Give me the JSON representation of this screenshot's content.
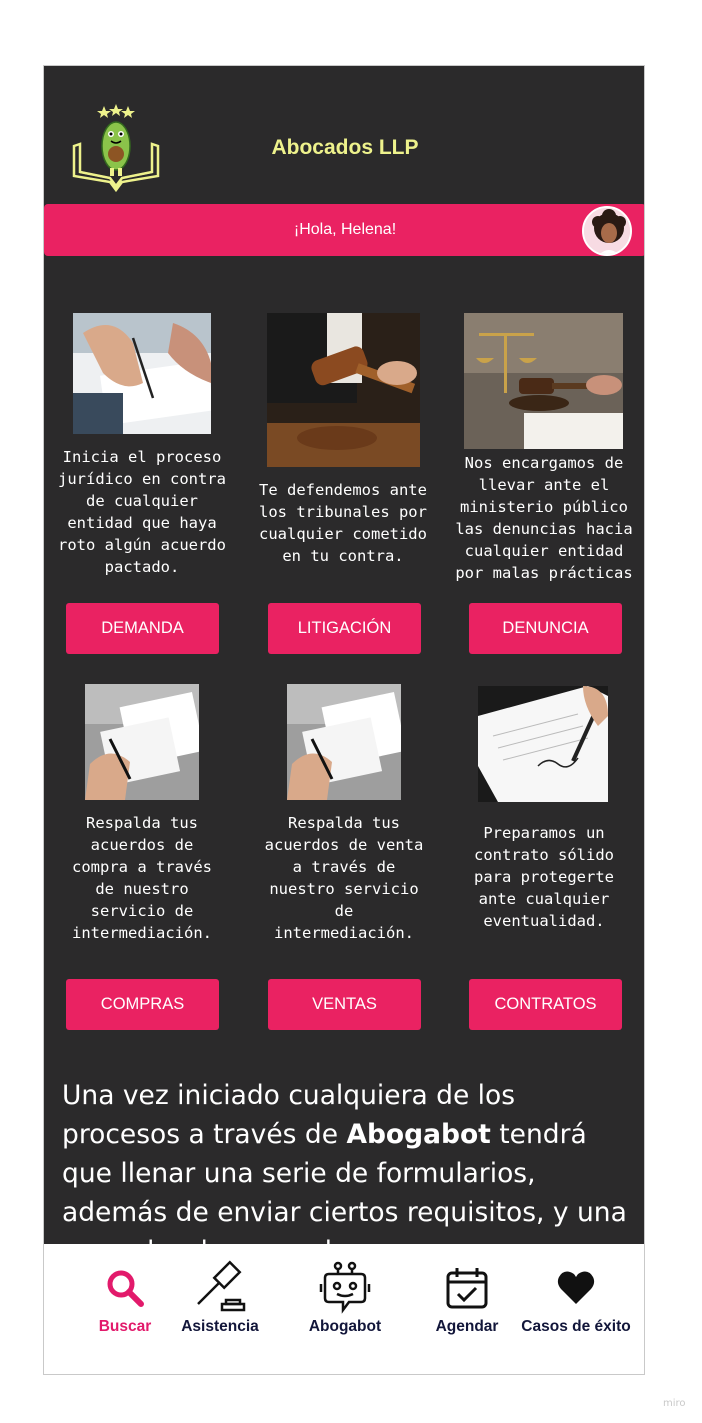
{
  "app": {
    "title": "Abocados LLP"
  },
  "greeting": {
    "text": "¡Hola, Helena!"
  },
  "services": [
    {
      "image": "contract-signing-photo",
      "description": "Inicia el proceso jurídico en contra de cualquier entidad que haya roto algún acuerdo pactado.",
      "button": "DEMANDA"
    },
    {
      "image": "judge-gavel-photo",
      "description": "Te defendemos ante los tribunales por cualquier cometido en tu contra.",
      "button": "LITIGACIÓN"
    },
    {
      "image": "scales-of-justice-photo",
      "description": "Nos encargamos de llevar ante el ministerio público las denuncias hacia cualquier entidad por malas prácticas",
      "button": "DENUNCIA"
    },
    {
      "image": "signing-document-photo",
      "description": "Respalda tus acuerdos de compra a través de nuestro servicio de intermediación.",
      "button": "COMPRAS"
    },
    {
      "image": "signing-document-photo",
      "description": "Respalda tus acuerdos de venta a través de nuestro servicio de intermediación.",
      "button": "VENTAS"
    },
    {
      "image": "pen-signing-contract-photo",
      "description": "Preparamos un contrato sólido para protegerte ante cualquier eventualidad.",
      "button": "CONTRATOS"
    }
  ],
  "intro": {
    "part1": "Una vez iniciado cualquiera de los procesos a través de ",
    "brand": "Abogabot",
    "part2": " tendrá que llenar una serie de formularios, además de enviar ciertos requisitos, y una vez cobrado, procederemos con su caso y el seguimiento ideal."
  },
  "nav": {
    "active": "Buscar",
    "items": [
      {
        "label": "Buscar",
        "icon": "search-icon"
      },
      {
        "label": "Asistencia",
        "icon": "gavel-icon"
      },
      {
        "label": "Abogabot",
        "icon": "robot-icon"
      },
      {
        "label": "Agendar",
        "icon": "calendar-check-icon"
      },
      {
        "label": "Casos de éxito",
        "icon": "heart-icon"
      }
    ]
  },
  "colors": {
    "accent": "#ea2262",
    "background": "#2b2a2b",
    "title": "#eef28c",
    "nav_text": "#12163a",
    "nav_active": "#e21a6b"
  },
  "watermark": "miro"
}
